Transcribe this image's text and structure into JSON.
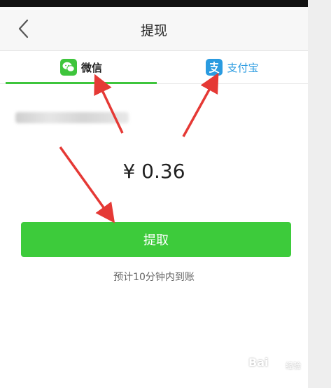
{
  "nav": {
    "title": "提现"
  },
  "tabs": [
    {
      "label": "微信",
      "icon": "wechat-icon",
      "color": "#3ec53c"
    },
    {
      "label": "支付宝",
      "icon": "alipay-icon",
      "color": "#2a9be0"
    }
  ],
  "withdraw": {
    "amount": "¥ 0.36",
    "button_label": "提取",
    "hint": "预计10分钟内到账"
  },
  "watermark": {
    "brand": "Bai",
    "sub": "经验"
  },
  "colors": {
    "accent_green": "#3dcb3b",
    "alipay_blue": "#2a9be0",
    "arrow_red": "#e53935"
  }
}
